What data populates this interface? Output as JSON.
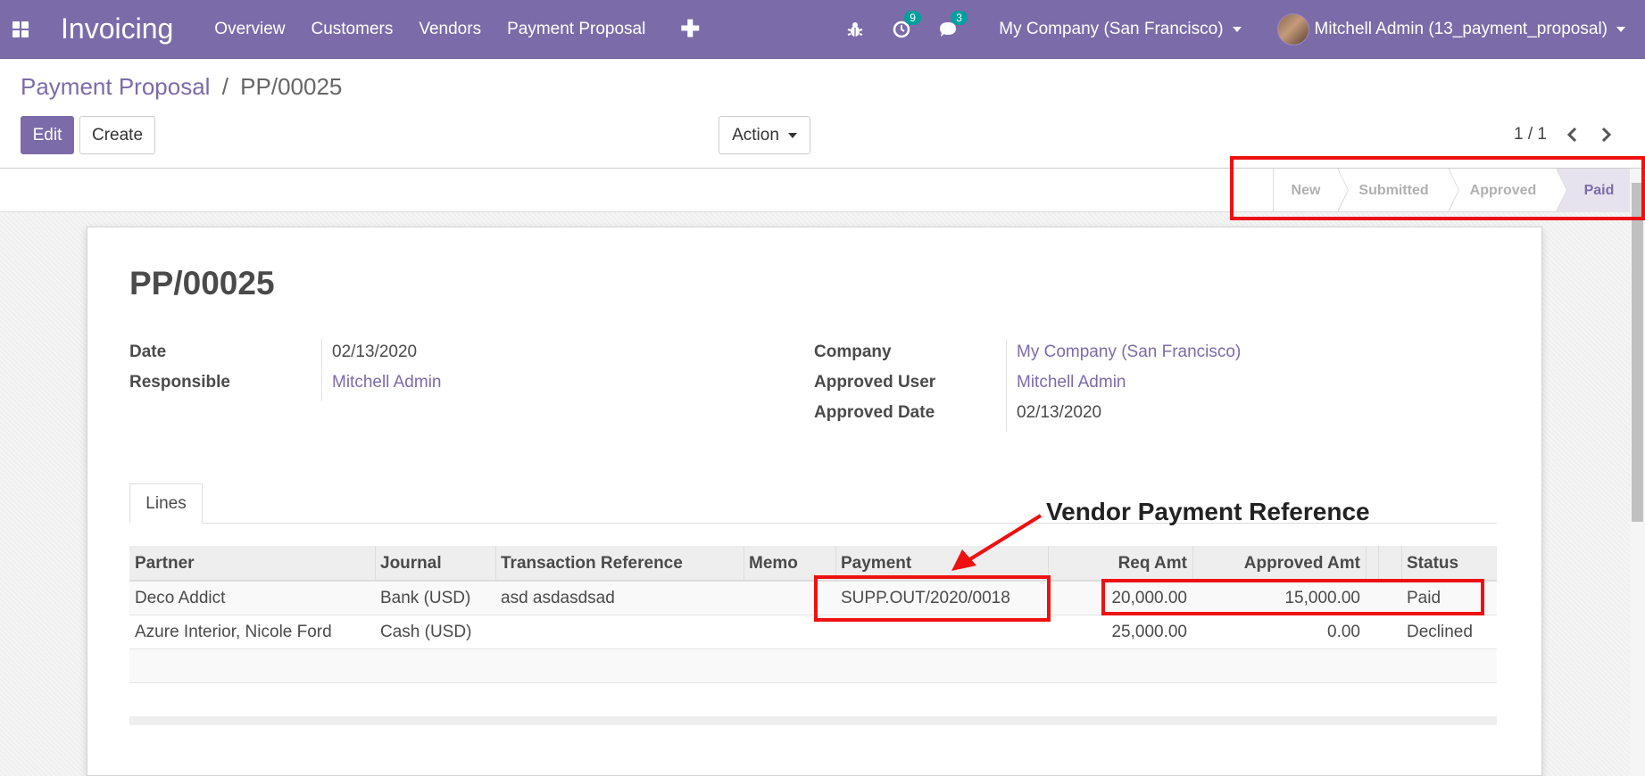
{
  "navbar": {
    "brand": "Invoicing",
    "menu": [
      "Overview",
      "Customers",
      "Vendors",
      "Payment Proposal"
    ],
    "activities_count": "9",
    "messages_count": "3",
    "company": "My Company (San Francisco)",
    "user": "Mitchell Admin (13_payment_proposal)"
  },
  "breadcrumb": {
    "parent": "Payment Proposal",
    "separator": "/",
    "current": "PP/00025"
  },
  "buttons": {
    "edit": "Edit",
    "create": "Create",
    "action": "Action"
  },
  "pager": {
    "value": "1 / 1"
  },
  "statusbar": {
    "steps": [
      "New",
      "Submitted",
      "Approved",
      "Paid"
    ],
    "active": "Paid"
  },
  "record": {
    "name": "PP/00025",
    "fields": {
      "date_label": "Date",
      "date": "02/13/2020",
      "responsible_label": "Responsible",
      "responsible": "Mitchell Admin",
      "company_label": "Company",
      "company": "My Company (San Francisco)",
      "approved_user_label": "Approved User",
      "approved_user": "Mitchell Admin",
      "approved_date_label": "Approved Date",
      "approved_date": "02/13/2020"
    }
  },
  "tabs": [
    "Lines"
  ],
  "table": {
    "columns": [
      "Partner",
      "Journal",
      "Transaction Reference",
      "Memo",
      "Payment",
      "Req Amt",
      "Approved Amt",
      "Status"
    ],
    "rows": [
      {
        "partner": "Deco Addict",
        "journal": "Bank (USD)",
        "transaction_ref": "asd asdasdsad",
        "memo": "",
        "payment": "SUPP.OUT/2020/0018",
        "req_amt": "20,000.00",
        "approved_amt": "15,000.00",
        "status": "Paid"
      },
      {
        "partner": "Azure Interior, Nicole Ford",
        "journal": "Cash (USD)",
        "transaction_ref": "",
        "memo": "",
        "payment": "",
        "req_amt": "25,000.00",
        "approved_amt": "0.00",
        "status": "Declined"
      }
    ]
  },
  "annotation": {
    "label": "Vendor Payment Reference",
    "color": "#ee1111"
  },
  "colors": {
    "brand": "#7c6ba9",
    "badge": "#00a09d"
  }
}
